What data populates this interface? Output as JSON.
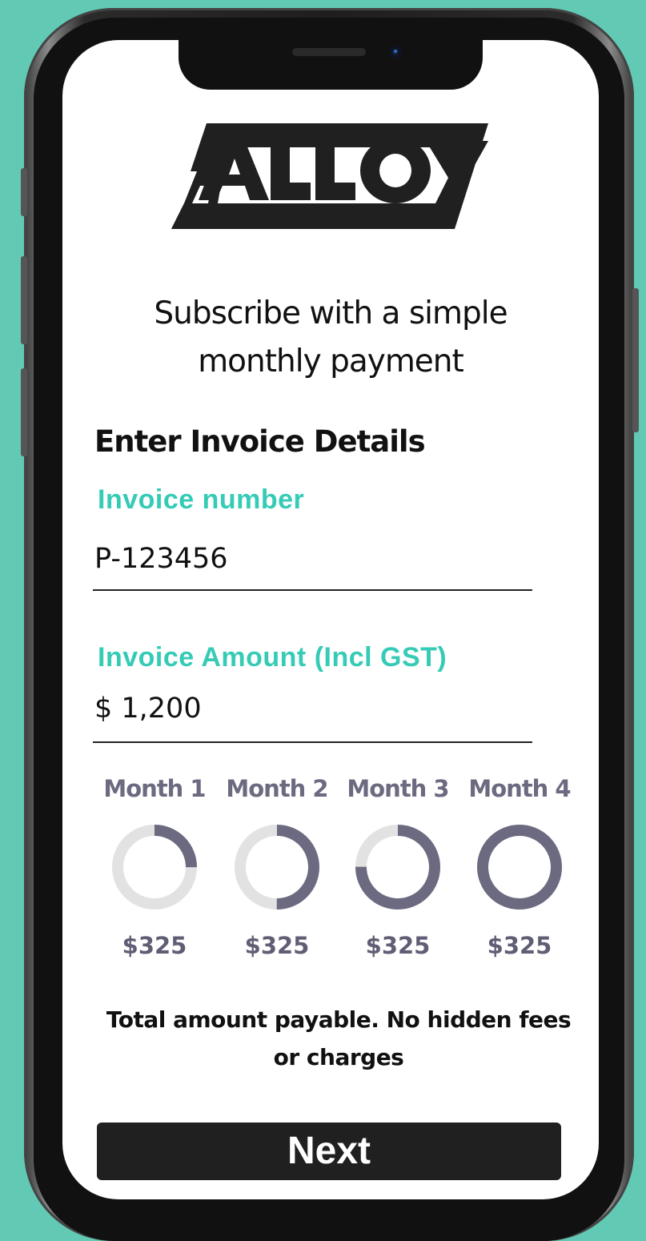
{
  "brand": {
    "logo_text": "ALLOY"
  },
  "tagline": {
    "line1": "Subscribe with a simple",
    "line2": "monthly payment"
  },
  "form": {
    "section_title": "Enter Invoice Details",
    "invoice_number": {
      "label": "Invoice number",
      "value": "P-123456"
    },
    "invoice_amount": {
      "label": "Invoice Amount (Incl GST)",
      "value": "$ 1,200"
    }
  },
  "schedule": {
    "months": [
      {
        "label": "Month 1",
        "amount": "$325",
        "progress": 0.25
      },
      {
        "label": "Month 2",
        "amount": "$325",
        "progress": 0.5
      },
      {
        "label": "Month 3",
        "amount": "$325",
        "progress": 0.75
      },
      {
        "label": "Month 4",
        "amount": "$325",
        "progress": 1.0
      }
    ]
  },
  "note": {
    "line1": "Total amount payable. No hidden fees",
    "line2": "or charges"
  },
  "actions": {
    "next_label": "Next"
  },
  "colors": {
    "background": "#62cab4",
    "accent": "#35cbb6",
    "ring_fill": "#6b6a80",
    "ring_track": "#e2e2e2",
    "button": "#202020"
  }
}
